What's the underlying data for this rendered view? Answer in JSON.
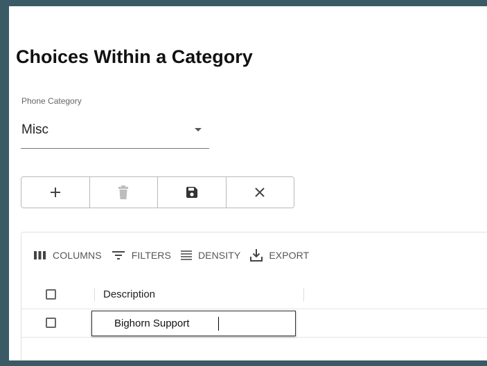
{
  "page": {
    "title": "Choices Within a Category"
  },
  "category_select": {
    "label": "Phone Category",
    "value": "Misc"
  },
  "action_toolbar": {
    "buttons": [
      {
        "icon": "plus-icon"
      },
      {
        "icon": "trash-icon",
        "disabled": true
      },
      {
        "icon": "save-icon"
      },
      {
        "icon": "close-icon"
      }
    ]
  },
  "grid_toolbar": {
    "columns_label": "COLUMNS",
    "filters_label": "FILTERS",
    "density_label": "DENSITY",
    "export_label": "EXPORT"
  },
  "grid": {
    "columns": [
      {
        "header": "Description"
      }
    ],
    "rows": [
      {
        "description": "Bighorn Support",
        "editing": true
      }
    ]
  },
  "colors": {
    "border": "#3a5a66",
    "disabled_icon": "#bdbdbd",
    "icon": "#444444"
  }
}
